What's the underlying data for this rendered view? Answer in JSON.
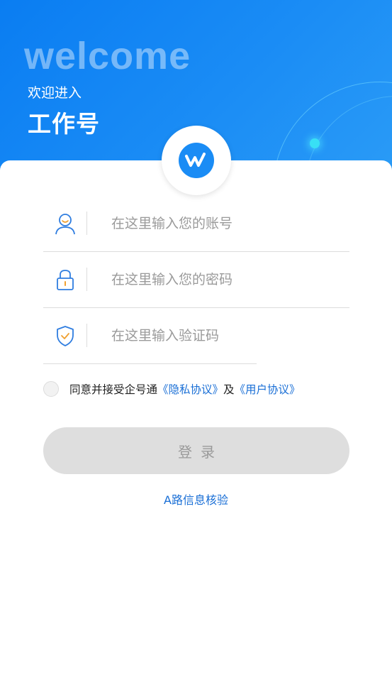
{
  "header": {
    "welcome": "welcome",
    "subtitle": "欢迎进入",
    "title": "工作号"
  },
  "form": {
    "account_placeholder": "在这里输入您的账号",
    "password_placeholder": "在这里输入您的密码",
    "captcha_placeholder": "在这里输入验证码"
  },
  "agreement": {
    "prefix": "同意并接受企号通",
    "privacy_link": "《隐私协议》",
    "and": "及",
    "user_link": "《用户协议》"
  },
  "login_button": "登录",
  "verify_link": "A路信息核验",
  "colors": {
    "primary": "#1a8cf5",
    "link": "#1a6fd6",
    "button_disabled": "#dedede"
  },
  "icons": [
    "logo-icon",
    "user-icon",
    "lock-icon",
    "shield-check-icon"
  ]
}
